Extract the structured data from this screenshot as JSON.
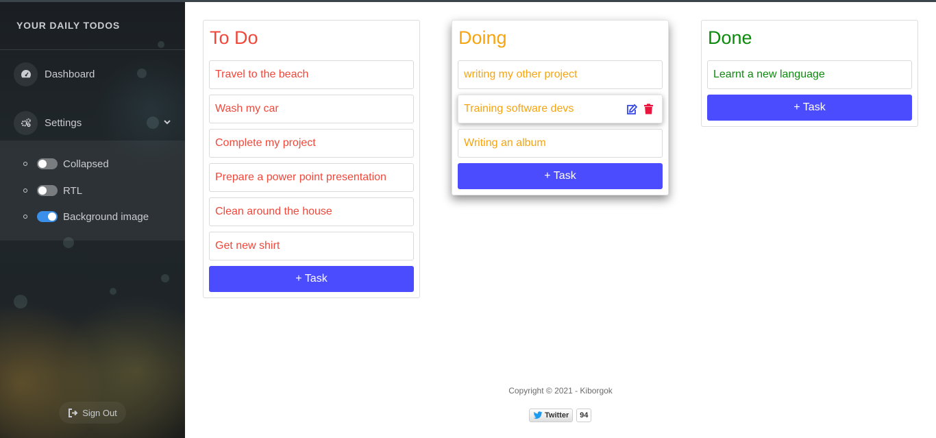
{
  "sidebar": {
    "brand": "YOUR DAILY TODOS",
    "menu": [
      {
        "label": "Dashboard",
        "icon": "dashboard-icon"
      },
      {
        "label": "Settings",
        "icon": "gears-icon"
      }
    ],
    "settings": [
      {
        "label": "Collapsed",
        "on": false
      },
      {
        "label": "RTL",
        "on": false
      },
      {
        "label": "Background image",
        "on": true
      }
    ],
    "signout": "Sign Out"
  },
  "boards": {
    "todo": {
      "title": "To Do",
      "color": "#f0473a",
      "tasks": [
        "Travel to the beach",
        "Wash my car",
        "Complete my project",
        "Prepare a power point presentation",
        "Clean around the house",
        "Get new shirt"
      ],
      "add_label": "+ Task"
    },
    "doing": {
      "title": "Doing",
      "color": "#f6a40f",
      "tasks": [
        "writing my other project",
        "Training software devs",
        "Writing an album"
      ],
      "add_label": "+ Task"
    },
    "done": {
      "title": "Done",
      "color": "#0c8a0c",
      "tasks": [
        "Learnt a new language"
      ],
      "add_label": "+ Task"
    }
  },
  "accent": "#4c4cff",
  "footer": {
    "copyright": "Copyright © 2021 - Kiborgok",
    "twitter_label": "Twitter",
    "twitter_count": "94"
  }
}
